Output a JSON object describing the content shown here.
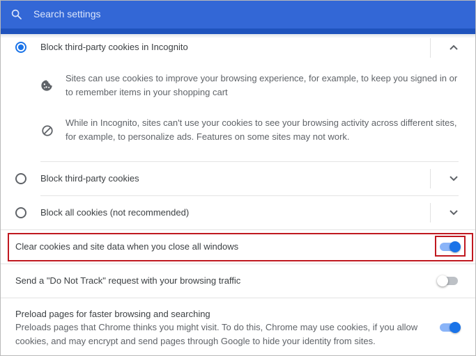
{
  "search": {
    "placeholder": "Search settings",
    "icon": "search-icon"
  },
  "cookie_options": [
    {
      "label": "Block third-party cookies in Incognito",
      "selected": true,
      "expanded": true,
      "details": [
        {
          "icon": "cookie-icon",
          "text_line1": "Sites can use cookies to improve your browsing experience, for example, to keep you signed in or",
          "text_line2": "to remember items in your shopping cart"
        },
        {
          "icon": "block-icon",
          "text_line1": "While in Incognito, sites can't use your cookies to see your browsing activity across different sites,",
          "text_line2": "for example, to personalize ads. Features on some sites may not work."
        }
      ]
    },
    {
      "label": "Block third-party cookies",
      "selected": false,
      "expanded": false
    },
    {
      "label": "Block all cookies (not recommended)",
      "selected": false,
      "expanded": false
    }
  ],
  "settings": [
    {
      "label": "Clear cookies and site data when you close all windows",
      "enabled": true,
      "highlighted": true
    },
    {
      "label": "Send a \"Do Not Track\" request with your browsing traffic",
      "enabled": false
    },
    {
      "label": "Preload pages for faster browsing and searching",
      "description_line1": "Preloads pages that Chrome thinks you might visit. To do this, Chrome may use cookies, if you allow",
      "description_line2": "cookies, and may encrypt and send pages through Google to hide your identity from sites.",
      "enabled": true
    }
  ],
  "colors": {
    "header": "#3367d6",
    "accent": "#1a73e8",
    "highlight": "#c0181f"
  }
}
